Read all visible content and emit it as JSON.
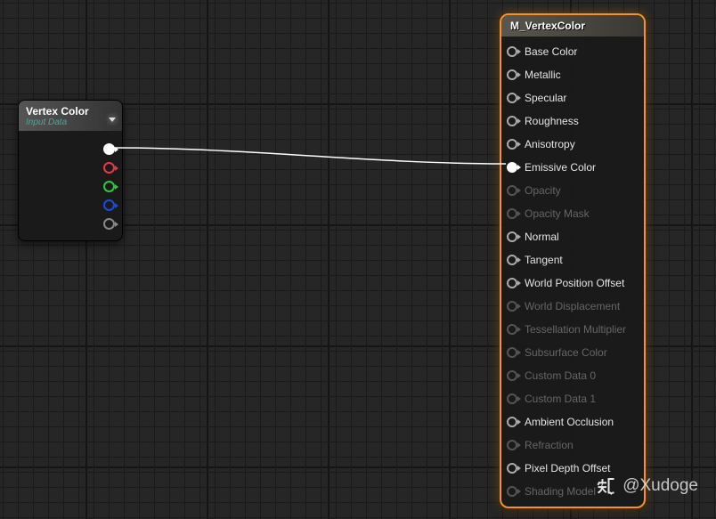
{
  "source_node": {
    "title": "Vertex Color",
    "subtitle": "Input Data",
    "outputs": [
      {
        "color": "white",
        "filled": true,
        "name": "rgba-output"
      },
      {
        "color": "red",
        "filled": false,
        "name": "r-output"
      },
      {
        "color": "green",
        "filled": false,
        "name": "g-output"
      },
      {
        "color": "blue",
        "filled": false,
        "name": "b-output"
      },
      {
        "color": "gray",
        "filled": false,
        "name": "a-output"
      }
    ]
  },
  "output_node": {
    "title": "M_VertexColor",
    "inputs": [
      {
        "label": "Base Color",
        "enabled": true,
        "connected": false
      },
      {
        "label": "Metallic",
        "enabled": true,
        "connected": false
      },
      {
        "label": "Specular",
        "enabled": true,
        "connected": false
      },
      {
        "label": "Roughness",
        "enabled": true,
        "connected": false
      },
      {
        "label": "Anisotropy",
        "enabled": true,
        "connected": false
      },
      {
        "label": "Emissive Color",
        "enabled": true,
        "connected": true
      },
      {
        "label": "Opacity",
        "enabled": false,
        "connected": false
      },
      {
        "label": "Opacity Mask",
        "enabled": false,
        "connected": false
      },
      {
        "label": "Normal",
        "enabled": true,
        "connected": false
      },
      {
        "label": "Tangent",
        "enabled": true,
        "connected": false
      },
      {
        "label": "World Position Offset",
        "enabled": true,
        "connected": false
      },
      {
        "label": "World Displacement",
        "enabled": false,
        "connected": false
      },
      {
        "label": "Tessellation Multiplier",
        "enabled": false,
        "connected": false
      },
      {
        "label": "Subsurface Color",
        "enabled": false,
        "connected": false
      },
      {
        "label": "Custom Data 0",
        "enabled": false,
        "connected": false
      },
      {
        "label": "Custom Data 1",
        "enabled": false,
        "connected": false
      },
      {
        "label": "Ambient Occlusion",
        "enabled": true,
        "connected": false
      },
      {
        "label": "Refraction",
        "enabled": false,
        "connected": false
      },
      {
        "label": "Pixel Depth Offset",
        "enabled": true,
        "connected": false
      },
      {
        "label": "Shading Model",
        "enabled": false,
        "connected": false
      }
    ]
  },
  "watermark": "@Xudoge",
  "connection": {
    "from": "rgba-output",
    "to": "Emissive Color"
  }
}
